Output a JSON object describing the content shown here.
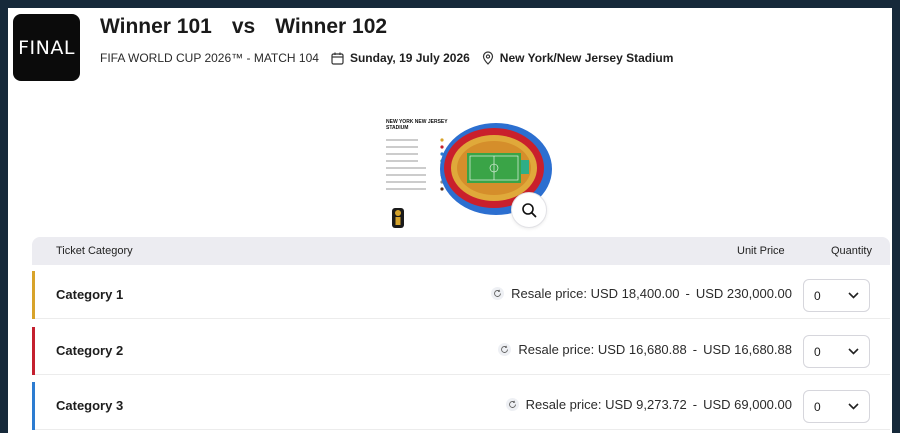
{
  "match": {
    "badge": "FINAL",
    "team_home": "Winner 101",
    "vs": "vs",
    "team_away": "Winner 102",
    "competition": "FIFA WORLD CUP 2026™ - MATCH 104",
    "date": "Sunday, 19 July 2026",
    "venue": "New York/New Jersey Stadium"
  },
  "map": {
    "title_line1": "NEW YORK NEW JERSEY",
    "title_line2": "STADIUM",
    "zoom_icon": "magnifier-icon"
  },
  "table": {
    "col_category": "Ticket Category",
    "col_price": "Unit Price",
    "col_quantity": "Quantity",
    "rows": [
      {
        "category": "Category 1",
        "price_label": "Resale price:",
        "price_from": "USD 18,400.00",
        "price_to": "USD 230,000.00",
        "quantity": "0",
        "color": "#d8a32a"
      },
      {
        "category": "Category 2",
        "price_label": "Resale price:",
        "price_from": "USD 16,680.88",
        "price_to": "USD 16,680.88",
        "quantity": "0",
        "color": "#c4202f"
      },
      {
        "category": "Category 3",
        "price_label": "Resale price:",
        "price_from": "USD 9,273.72",
        "price_to": "USD 69,000.00",
        "quantity": "0",
        "color": "#2c7cd1"
      }
    ]
  },
  "colors": {
    "backdrop": "#16293a",
    "header_bg": "#ececf1",
    "category_1": "#d8a32a",
    "category_2": "#c4202f",
    "category_3": "#2c7cd1"
  }
}
